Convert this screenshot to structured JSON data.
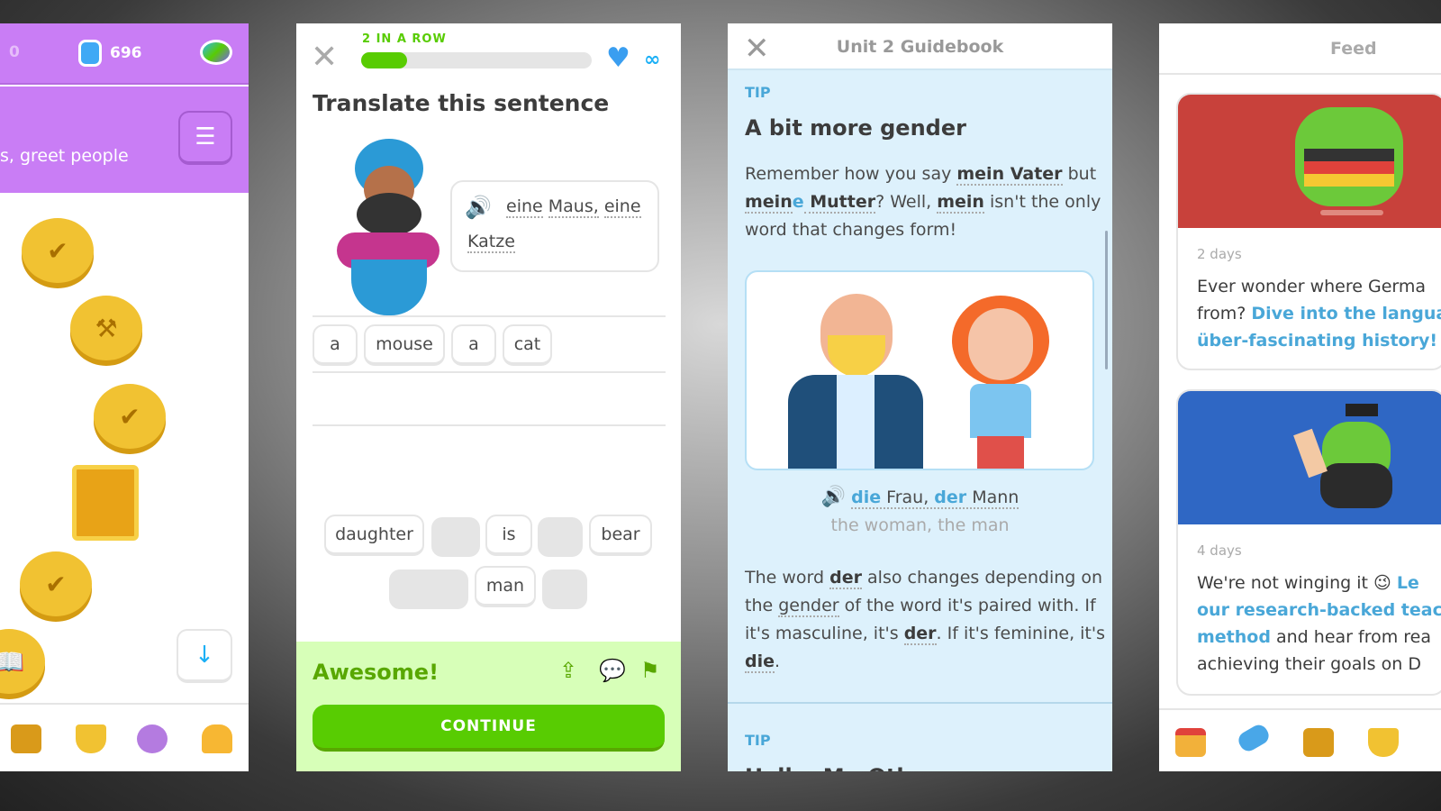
{
  "path_screen": {
    "streak": "0",
    "gems": "696",
    "unit_subtitle": "s, greet people",
    "guidebook_icon": "notebook-icon",
    "nav_icons": [
      "chest-icon",
      "shield-icon",
      "avatar-icon",
      "bell-icon"
    ],
    "accent": "#c97df5"
  },
  "lesson": {
    "streak_label": "2 IN A ROW",
    "progress_percent": 20,
    "hearts": "∞",
    "prompt": "Translate this sentence",
    "speech": {
      "line1": [
        "eine",
        "Maus,",
        "eine"
      ],
      "line2": "Katze"
    },
    "answer_words": [
      "a",
      "mouse",
      "a",
      "cat"
    ],
    "bank_row1": [
      "daughter",
      "",
      "is",
      "",
      "bear"
    ],
    "bank_row2": [
      "",
      "man",
      ""
    ],
    "feedback": "Awesome!",
    "continue_label": "CONTINUE",
    "success_color": "#58cc02"
  },
  "guidebook": {
    "title": "Unit 2 Guidebook",
    "tip_label": "TIP",
    "heading": "A bit more gender",
    "p1": {
      "a": "Remember how you say ",
      "b": "mein Vater",
      "c": " but",
      "d": "mein",
      "e": "e",
      "f": " Mutter",
      "g": "? Well, ",
      "h": "mein",
      "i": " isn't the only",
      "j": "word that changes form!"
    },
    "example": {
      "w1": "die",
      "w2": " Frau, ",
      "w3": "der",
      "w4": " Mann",
      "translation": "the woman, the man"
    },
    "p2": {
      "a": "The word ",
      "b": "der",
      "c": " also changes depending on",
      "d": "the ",
      "e": "gender",
      "f": " of the word it's paired with. If",
      "g": "it's masculine, it's ",
      "h": "der",
      "i": ". If it's feminine, it's",
      "j": "die",
      "k": "."
    },
    "tip2_label": "TIP",
    "tip2_heading": "Hallo, Mr. Oth"
  },
  "feed": {
    "title": "Feed",
    "posts": [
      {
        "time": "2 days",
        "l1": "Ever wonder where Germa",
        "l2a": "from? ",
        "l2b": "Dive into the langua",
        "l3": "über-fascinating history!"
      },
      {
        "time": "4 days",
        "l1a": "We're not winging it 😉 ",
        "l1b": "Le",
        "l2": "our research-backed teac",
        "l3a": "method",
        "l3b": " and hear from rea",
        "l4": "achieving their goals on D"
      }
    ],
    "nav_icons": [
      "home-icon",
      "dumbbell-icon",
      "chest-icon",
      "shield-icon"
    ]
  }
}
